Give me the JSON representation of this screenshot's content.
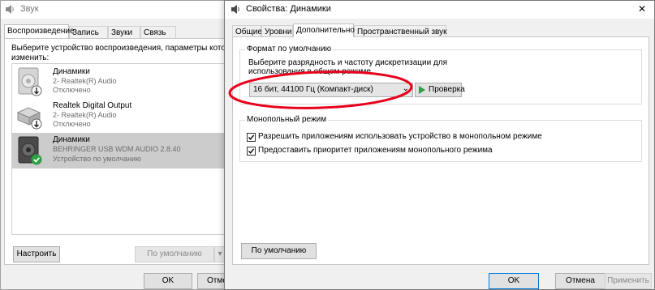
{
  "back_window": {
    "title": "Звук",
    "tabs": [
      "Воспроизведение",
      "Запись",
      "Звуки",
      "Связь"
    ],
    "instruction_line1": "Выберите устройство воспроизведения, параметры которого",
    "instruction_line2": "изменить:",
    "devices": [
      {
        "name": "Динамики",
        "sub1": "2- Realtek(R) Audio",
        "sub2": "Отключено"
      },
      {
        "name": "Realtek Digital Output",
        "sub1": "2- Realtek(R) Audio",
        "sub2": "Отключено"
      },
      {
        "name": "Динамики",
        "sub1": "BEHRINGER USB WDM AUDIO 2.8.40",
        "sub2": "Устройство по умолчанию"
      }
    ],
    "configure_label": "Настроить",
    "default_label": "По умолчанию",
    "ok_label": "OK",
    "cancel_label": "Отме"
  },
  "front_window": {
    "title": "Свойства: Динамики",
    "close_glyph": "✕",
    "tabs": [
      "Общие",
      "Уровни",
      "Дополнительно",
      "Пространственный звук"
    ],
    "default_format": {
      "title": "Формат по умолчанию",
      "line1": "Выберите разрядность и частоту дискретизации для",
      "line2": "использования в общем режиме",
      "selected": "16 бит, 44100 Гц (Компакт-диск)",
      "test_label": "Проверка"
    },
    "exclusive": {
      "title": "Монопольный режим",
      "option1": "Разрешить приложениям использовать устройство в монопольном режиме",
      "option2": "Предоставить приоритет приложениям монопольного режима"
    },
    "restore_default_label": "По умолчанию",
    "ok_label": "OK",
    "cancel_label": "Отмена",
    "apply_label": "Применить"
  },
  "colors": {
    "annotation": "#e8001c",
    "selection": "#cce8ff",
    "accent": "#0078d7",
    "check_badge": "#2ea043"
  }
}
